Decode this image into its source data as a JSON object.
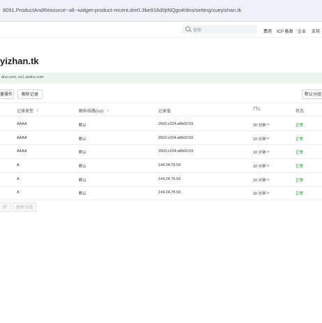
{
  "browser": {
    "url": "8091.ProductAndResource--all--widget-product-recent.dre0.3be916d0jtNQgo#/dns/setting/xueyizhan.tk"
  },
  "topnav": {
    "search_placeholder": "搜索",
    "links": [
      "费用",
      "ICP 备案",
      "企业",
      "支持"
    ]
  },
  "page": {
    "title": "yizhan.tk",
    "info": "dns.com, ns1.alidns.com"
  },
  "toolbar": {
    "left_buttons": [
      "量操作",
      "解析记录"
    ],
    "right_button": "默认分组"
  },
  "table": {
    "headers": [
      "记录类型",
      "解析线路(isp)",
      "记录值",
      "TTL",
      "状态"
    ],
    "rows": [
      {
        "type": "AAAA",
        "line": "默认",
        "value": "2603:c024:a8b00:59",
        "ttl": "10 分钟",
        "status": "正常"
      },
      {
        "type": "AAAA",
        "line": "默认",
        "value": "2603:c024:a8b00:59",
        "ttl": "10 分钟",
        "status": "正常"
      },
      {
        "type": "AAAA",
        "line": "默认",
        "value": "2603:c024:a8b00:59",
        "ttl": "10 分钟",
        "status": "正常"
      },
      {
        "type": "A",
        "line": "默认",
        "value": "144.24.78.59",
        "ttl": "10 分钟",
        "status": "正常"
      },
      {
        "type": "A",
        "line": "默认",
        "value": "144.24.78.59",
        "ttl": "10 分钟",
        "status": "正常"
      },
      {
        "type": "A",
        "line": "默认",
        "value": "144.24.78.59",
        "ttl": "10 分钟",
        "status": "正常"
      }
    ]
  },
  "footer": {
    "buttons": [
      "除",
      "更新分组"
    ]
  },
  "colors": {
    "status": "#1a8a3a",
    "infobar": "#edf6ee",
    "urlbar": "#eef1f7"
  }
}
